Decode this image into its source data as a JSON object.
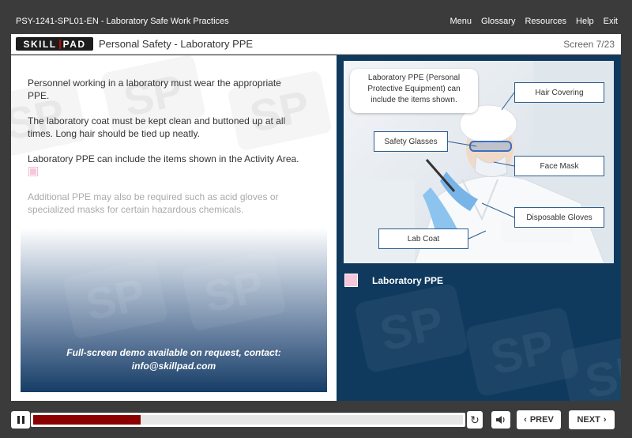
{
  "topbar": {
    "course_title": "PSY-1241-SPL01-EN - Laboratory Safe Work Practices",
    "menu": [
      "Menu",
      "Glossary",
      "Resources",
      "Help",
      "Exit"
    ]
  },
  "header": {
    "logo": "SKILLPAD",
    "logo_parts": [
      "SKILL",
      "PAD"
    ],
    "title": "Personal Safety - Laboratory PPE",
    "screen_count": "Screen 7/23"
  },
  "content": {
    "para1": "Personnel working in a laboratory must wear the appropriate PPE.",
    "para2": "The laboratory coat must be kept clean and buttoned up at all times. Long hair should be tied up neatly.",
    "para3": "Laboratory PPE can include the items shown in the Activity Area.",
    "para4": "Additional PPE may also be required such as acid gloves or specialized masks for certain hazardous chemicals.",
    "demo_line1": "Full-screen demo available on request, contact:",
    "demo_line2": "info@skillpad.com"
  },
  "activity": {
    "note": "Laboratory PPE (Personal Protective Equipment) can include the items shown.",
    "callouts": [
      "Hair Covering",
      "Safety Glasses",
      "Face Mask",
      "Disposable Gloves",
      "Lab Coat"
    ],
    "legend_label": "Laboratory PPE",
    "legend_color": "#f6c6dc",
    "watermark": "SP"
  },
  "controls": {
    "progress_fraction": 0.25,
    "prev_label": "PREV",
    "next_label": "NEXT",
    "accent_color": "#8b0000"
  }
}
